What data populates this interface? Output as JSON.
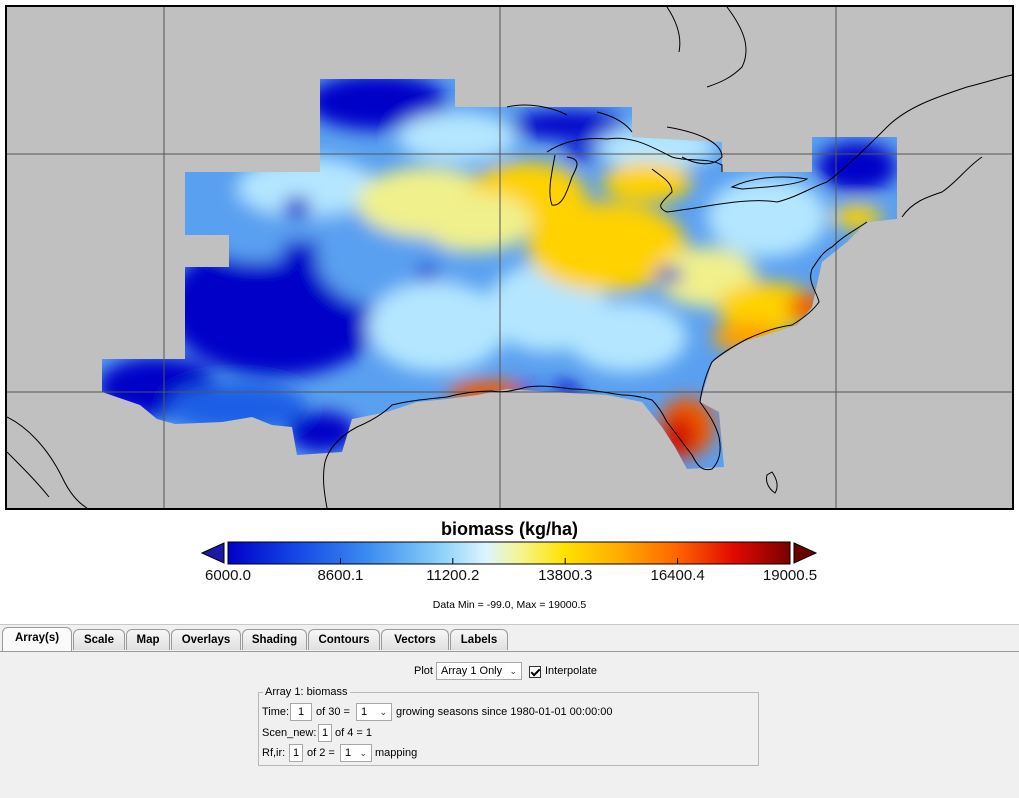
{
  "map": {
    "shading_colors": [
      "#0000c8",
      "#1e5fe6",
      "#5aa0f0",
      "#b4e6ff",
      "#f0f08c",
      "#ffd200",
      "#ffa000",
      "#f05a00",
      "#d21400",
      "#8c0000"
    ],
    "background_color": "#c0c0c0",
    "nodata_color": "#c0c0c0"
  },
  "colorbar": {
    "title": "biomass (kg/ha)",
    "ticks": [
      "6000.0",
      "8600.1",
      "11200.2",
      "13800.3",
      "16400.4",
      "19000.5"
    ],
    "min": 6000.0,
    "max": 19000.5,
    "low_cap_color": "#1a1aa8",
    "high_cap_color": "#6b0000"
  },
  "data_range_text": "Data Min = -99.0, Max = 19000.5",
  "tabs": [
    "Array(s)",
    "Scale",
    "Map",
    "Overlays",
    "Shading",
    "Contours",
    "Vectors",
    "Labels"
  ],
  "active_tab": "Array(s)",
  "plot": {
    "label": "Plot",
    "selected": "Array 1 Only",
    "interpolate_label": "Interpolate",
    "interpolate_checked": true
  },
  "array_group": {
    "title": "Array 1: biomass",
    "time": {
      "label": "Time:",
      "value": "1",
      "of_text": "of 30 =",
      "selected": "1",
      "suffix": "growing seasons since 1980-01-01 00:00:00"
    },
    "scen": {
      "label": "Scen_new:",
      "value": "1",
      "of_text": "of 4 = 1"
    },
    "rfir": {
      "label": "Rf,ir:",
      "value": "1",
      "of_text": "of 2 =",
      "selected": "1",
      "suffix": "mapping"
    }
  }
}
